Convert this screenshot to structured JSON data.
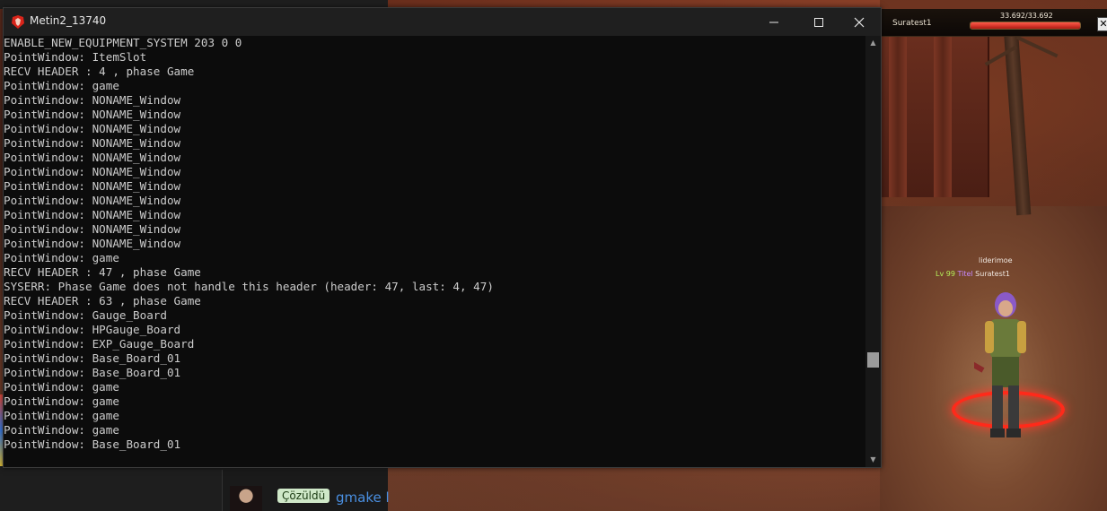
{
  "console": {
    "title": "Metin2_13740",
    "lines": [
      "ENABLE_NEW_EQUIPMENT_SYSTEM 203 0 0",
      "PointWindow: ItemSlot",
      "RECV HEADER : 4 , phase Game",
      "PointWindow: game",
      "PointWindow: NONAME_Window",
      "PointWindow: NONAME_Window",
      "PointWindow: NONAME_Window",
      "PointWindow: NONAME_Window",
      "PointWindow: NONAME_Window",
      "PointWindow: NONAME_Window",
      "PointWindow: NONAME_Window",
      "PointWindow: NONAME_Window",
      "PointWindow: NONAME_Window",
      "PointWindow: NONAME_Window",
      "PointWindow: NONAME_Window",
      "PointWindow: game",
      "RECV HEADER : 47 , phase Game",
      "SYSERR: Phase Game does not handle this header (header: 47, last: 4, 47)",
      "RECV HEADER : 63 , phase Game",
      "PointWindow: Gauge_Board",
      "PointWindow: HPGauge_Board",
      "PointWindow: EXP_Gauge_Board",
      "PointWindow: Base_Board_01",
      "PointWindow: Base_Board_01",
      "PointWindow: game",
      "PointWindow: game",
      "PointWindow: game",
      "PointWindow: game",
      "PointWindow: Base_Board_01"
    ],
    "scroll_position_fraction": 0.78
  },
  "game_hud": {
    "target_name": "Suratest1",
    "hp_text": "33.692/33.692",
    "hp_fraction": 1.0,
    "close_label": "✕"
  },
  "character": {
    "guild": "liderimoe",
    "level": "Lv 99",
    "title": "Titel",
    "name": "Suratest1"
  },
  "forum": {
    "badge": "Çözüldü",
    "title": "gmake l"
  },
  "colors": {
    "console_bg": "#0c0c0c",
    "console_text": "#cccccc",
    "titlebar": "#1f1f1f",
    "level_color": "#b6f05a",
    "title_color": "#c78aff",
    "hp_bar": "#e0302a",
    "ring": "#ff2a1a",
    "badge_bg": "#cfe8c8",
    "link": "#4a90e2"
  }
}
